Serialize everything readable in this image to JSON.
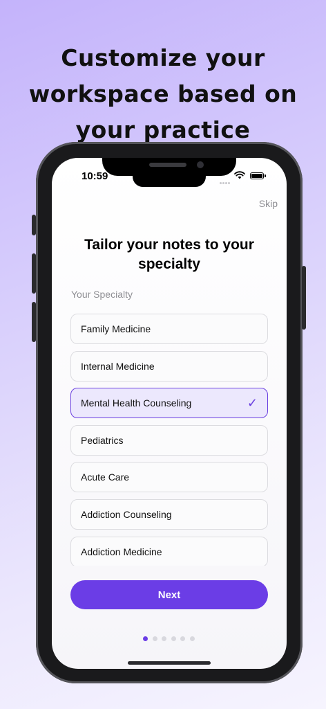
{
  "headline": "Customize your workspace based on your practice",
  "status_bar": {
    "time": "10:59",
    "signal_icon": "signal-dots-icon",
    "wifi_icon": "wifi-icon",
    "battery_icon": "battery-icon"
  },
  "skip_label": "Skip",
  "title": "Tailor your notes to your specialty",
  "section_label": "Your Specialty",
  "specialties": [
    {
      "label": "Family Medicine",
      "selected": false
    },
    {
      "label": "Internal Medicine",
      "selected": false
    },
    {
      "label": "Mental Health Counseling",
      "selected": true
    },
    {
      "label": "Pediatrics",
      "selected": false
    },
    {
      "label": "Acute Care",
      "selected": false
    },
    {
      "label": "Addiction Counseling",
      "selected": false
    },
    {
      "label": "Addiction Medicine",
      "selected": false
    }
  ],
  "check_glyph": "✓",
  "next_label": "Next",
  "pagination": {
    "total": 6,
    "current": 1
  },
  "colors": {
    "accent": "#6b3de6",
    "selected_bg": "#ece8fd"
  }
}
